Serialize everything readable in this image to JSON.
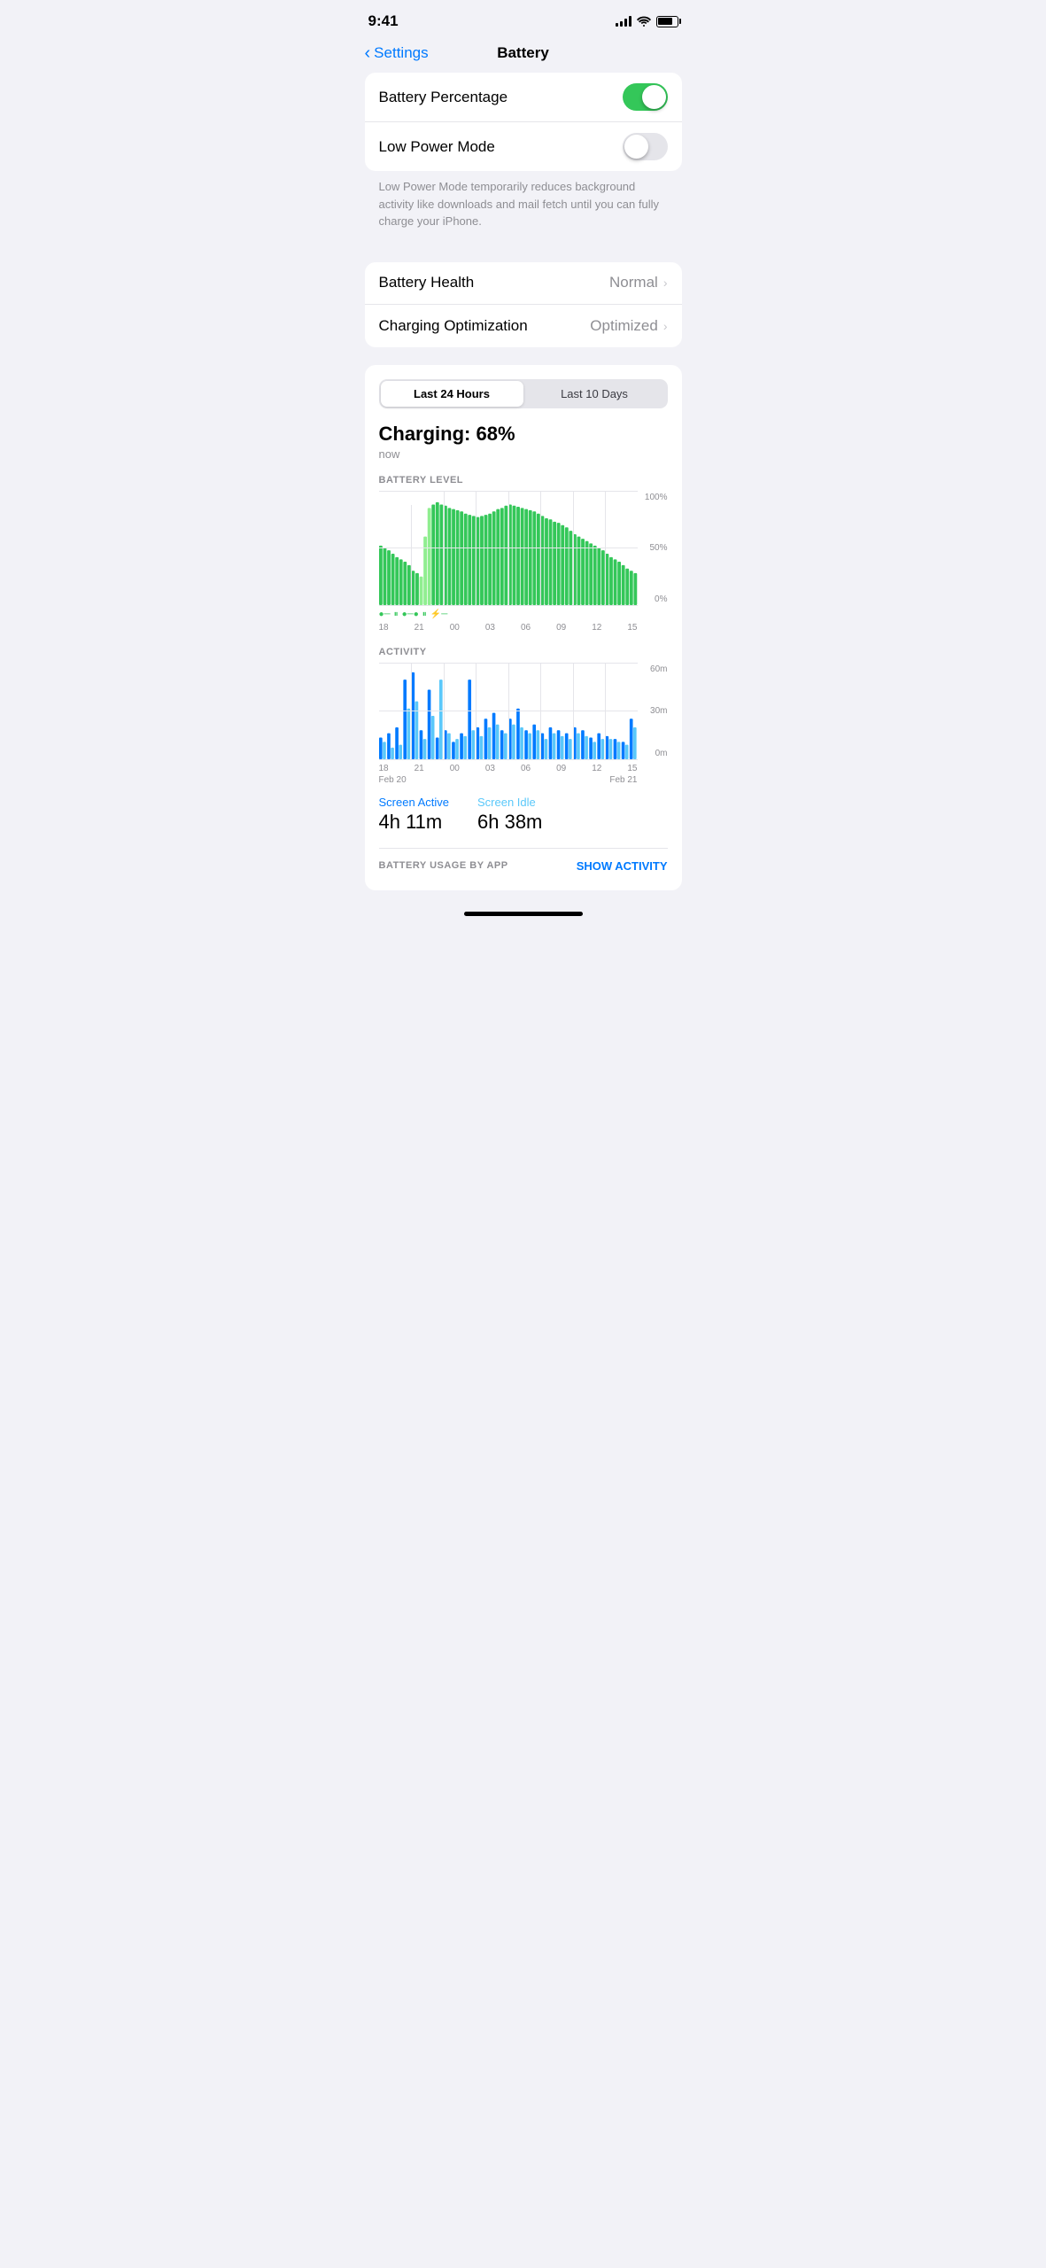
{
  "statusBar": {
    "time": "9:41"
  },
  "nav": {
    "back": "Settings",
    "title": "Battery"
  },
  "settings": {
    "batteryPercentage": {
      "label": "Battery Percentage",
      "value": true
    },
    "lowPowerMode": {
      "label": "Low Power Mode",
      "value": false,
      "description": "Low Power Mode temporarily reduces background activity like downloads and mail fetch until you can fully charge your iPhone."
    },
    "batteryHealth": {
      "label": "Battery Health",
      "value": "Normal"
    },
    "chargingOptimization": {
      "label": "Charging Optimization",
      "value": "Optimized"
    }
  },
  "chart": {
    "segmentOptions": [
      "Last 24 Hours",
      "Last 10 Days"
    ],
    "activeSegment": 0,
    "chargingLabel": "Charging: 68%",
    "chargingTime": "now",
    "batteryLevelLabel": "BATTERY LEVEL",
    "activityLabel": "ACTIVITY",
    "xLabels": [
      "18",
      "21",
      "00",
      "03",
      "06",
      "09",
      "12",
      "15"
    ],
    "xLabels2": [
      "18",
      "21",
      "00",
      "03",
      "06",
      "09",
      "12",
      "15"
    ],
    "yLabels": [
      "100%",
      "50%",
      "0%"
    ],
    "yLabels2": [
      "60m",
      "30m",
      "0m"
    ],
    "dateLabels": [
      "Feb 20",
      "Feb 21"
    ],
    "screenActive": {
      "label": "Screen Active",
      "value": "4h 11m"
    },
    "screenIdle": {
      "label": "Screen Idle",
      "value": "6h 38m"
    },
    "batteryUsageLabel": "BATTERY USAGE BY APP",
    "showActivityLabel": "SHOW ACTIVITY"
  }
}
